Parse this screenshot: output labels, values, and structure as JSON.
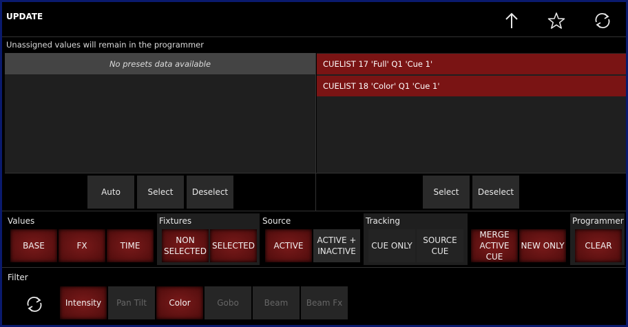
{
  "header": {
    "title": "UPDATE",
    "icons": [
      "arrow-up-icon",
      "star-icon",
      "refresh-icon"
    ]
  },
  "info_text": "Unassigned values will remain in the programmer",
  "presets": {
    "empty_text": "No presets data available",
    "buttons": {
      "auto": "Auto",
      "select": "Select",
      "deselect": "Deselect"
    }
  },
  "cuelists": {
    "items": [
      "CUELIST 17 'Full'   Q1 'Cue 1'",
      "CUELIST 18 'Color'   Q1 'Cue 1'"
    ],
    "buttons": {
      "select": "Select",
      "deselect": "Deselect"
    }
  },
  "options": {
    "values": {
      "label": "Values",
      "base": "BASE",
      "fx": "FX",
      "time": "TIME"
    },
    "fixtures": {
      "label": "Fixtures",
      "non_selected": "NON SELECTED",
      "selected": "SELECTED"
    },
    "source": {
      "label": "Source",
      "active": "ACTIVE",
      "active_inactive": "ACTIVE + INACTIVE"
    },
    "tracking": {
      "label": "Tracking",
      "cue_only": "CUE ONLY",
      "source_cue": "SOURCE CUE",
      "merge_active_cue": "MERGE ACTIVE CUE",
      "new_only": "NEW ONLY"
    },
    "programmer": {
      "label": "Programmer",
      "clear": "CLEAR"
    }
  },
  "filter": {
    "label": "Filter",
    "items": [
      {
        "label": "Intensity",
        "state": "active"
      },
      {
        "label": "Pan Tilt",
        "state": "disabled"
      },
      {
        "label": "Color",
        "state": "active"
      },
      {
        "label": "Gobo",
        "state": "disabled"
      },
      {
        "label": "Beam",
        "state": "disabled"
      },
      {
        "label": "Beam Fx",
        "state": "disabled"
      }
    ]
  },
  "colors": {
    "accent_red": "#7a1414",
    "background": "#000000",
    "frame": "#0a1a6e"
  }
}
